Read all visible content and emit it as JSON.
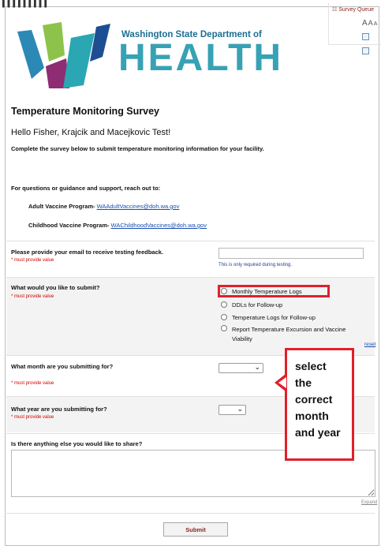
{
  "header": {
    "survey_queue": "Survey Queue",
    "font_sizes": [
      "A",
      "A",
      "A"
    ],
    "logo_dept": "Washington State Department of",
    "logo_word": "HEALTH",
    "icons": [
      "survey-queue-icon",
      "list-icon"
    ]
  },
  "intro": {
    "title": "Temperature Monitoring Survey",
    "greeting": "Hello Fisher, Krajcik and Macejkovic Test!",
    "description": "Complete the survey below to submit temperature monitoring information for your facility.",
    "support": "For questions or guidance and support, reach out to:",
    "adult_label": "Adult Vaccine Program-",
    "adult_email": "WAAdultVaccines@doh.wa.gov",
    "child_label": "Childhood Vaccine Program-",
    "child_email": "WAChildhoodVaccines@doh.wa.gov"
  },
  "questions": {
    "email_label": "Please provide your email to receive testing feedback.",
    "required": "* must provide value",
    "email_hint": "This is only required during testing.",
    "submit_label": "What would you like to submit?",
    "submit_options": [
      "Monthly Temperature Logs",
      "DDLs for Follow-up",
      "Temperature Logs for Follow-up",
      "Report Temperature Excursion and Vaccine Viability"
    ],
    "reset": "reset",
    "month_label": "What month are you submitting for?",
    "year_label": "What year are you submitting for?",
    "share_label": "Is there anything else you would like to share?",
    "expand": "Expand",
    "submit_button": "Submit"
  },
  "annotation": {
    "callout": "select the correct month and year"
  },
  "colors": {
    "highlight": "#e0202a",
    "logo_teal": "#37a2b3",
    "logo_navy": "#1d6e92"
  }
}
